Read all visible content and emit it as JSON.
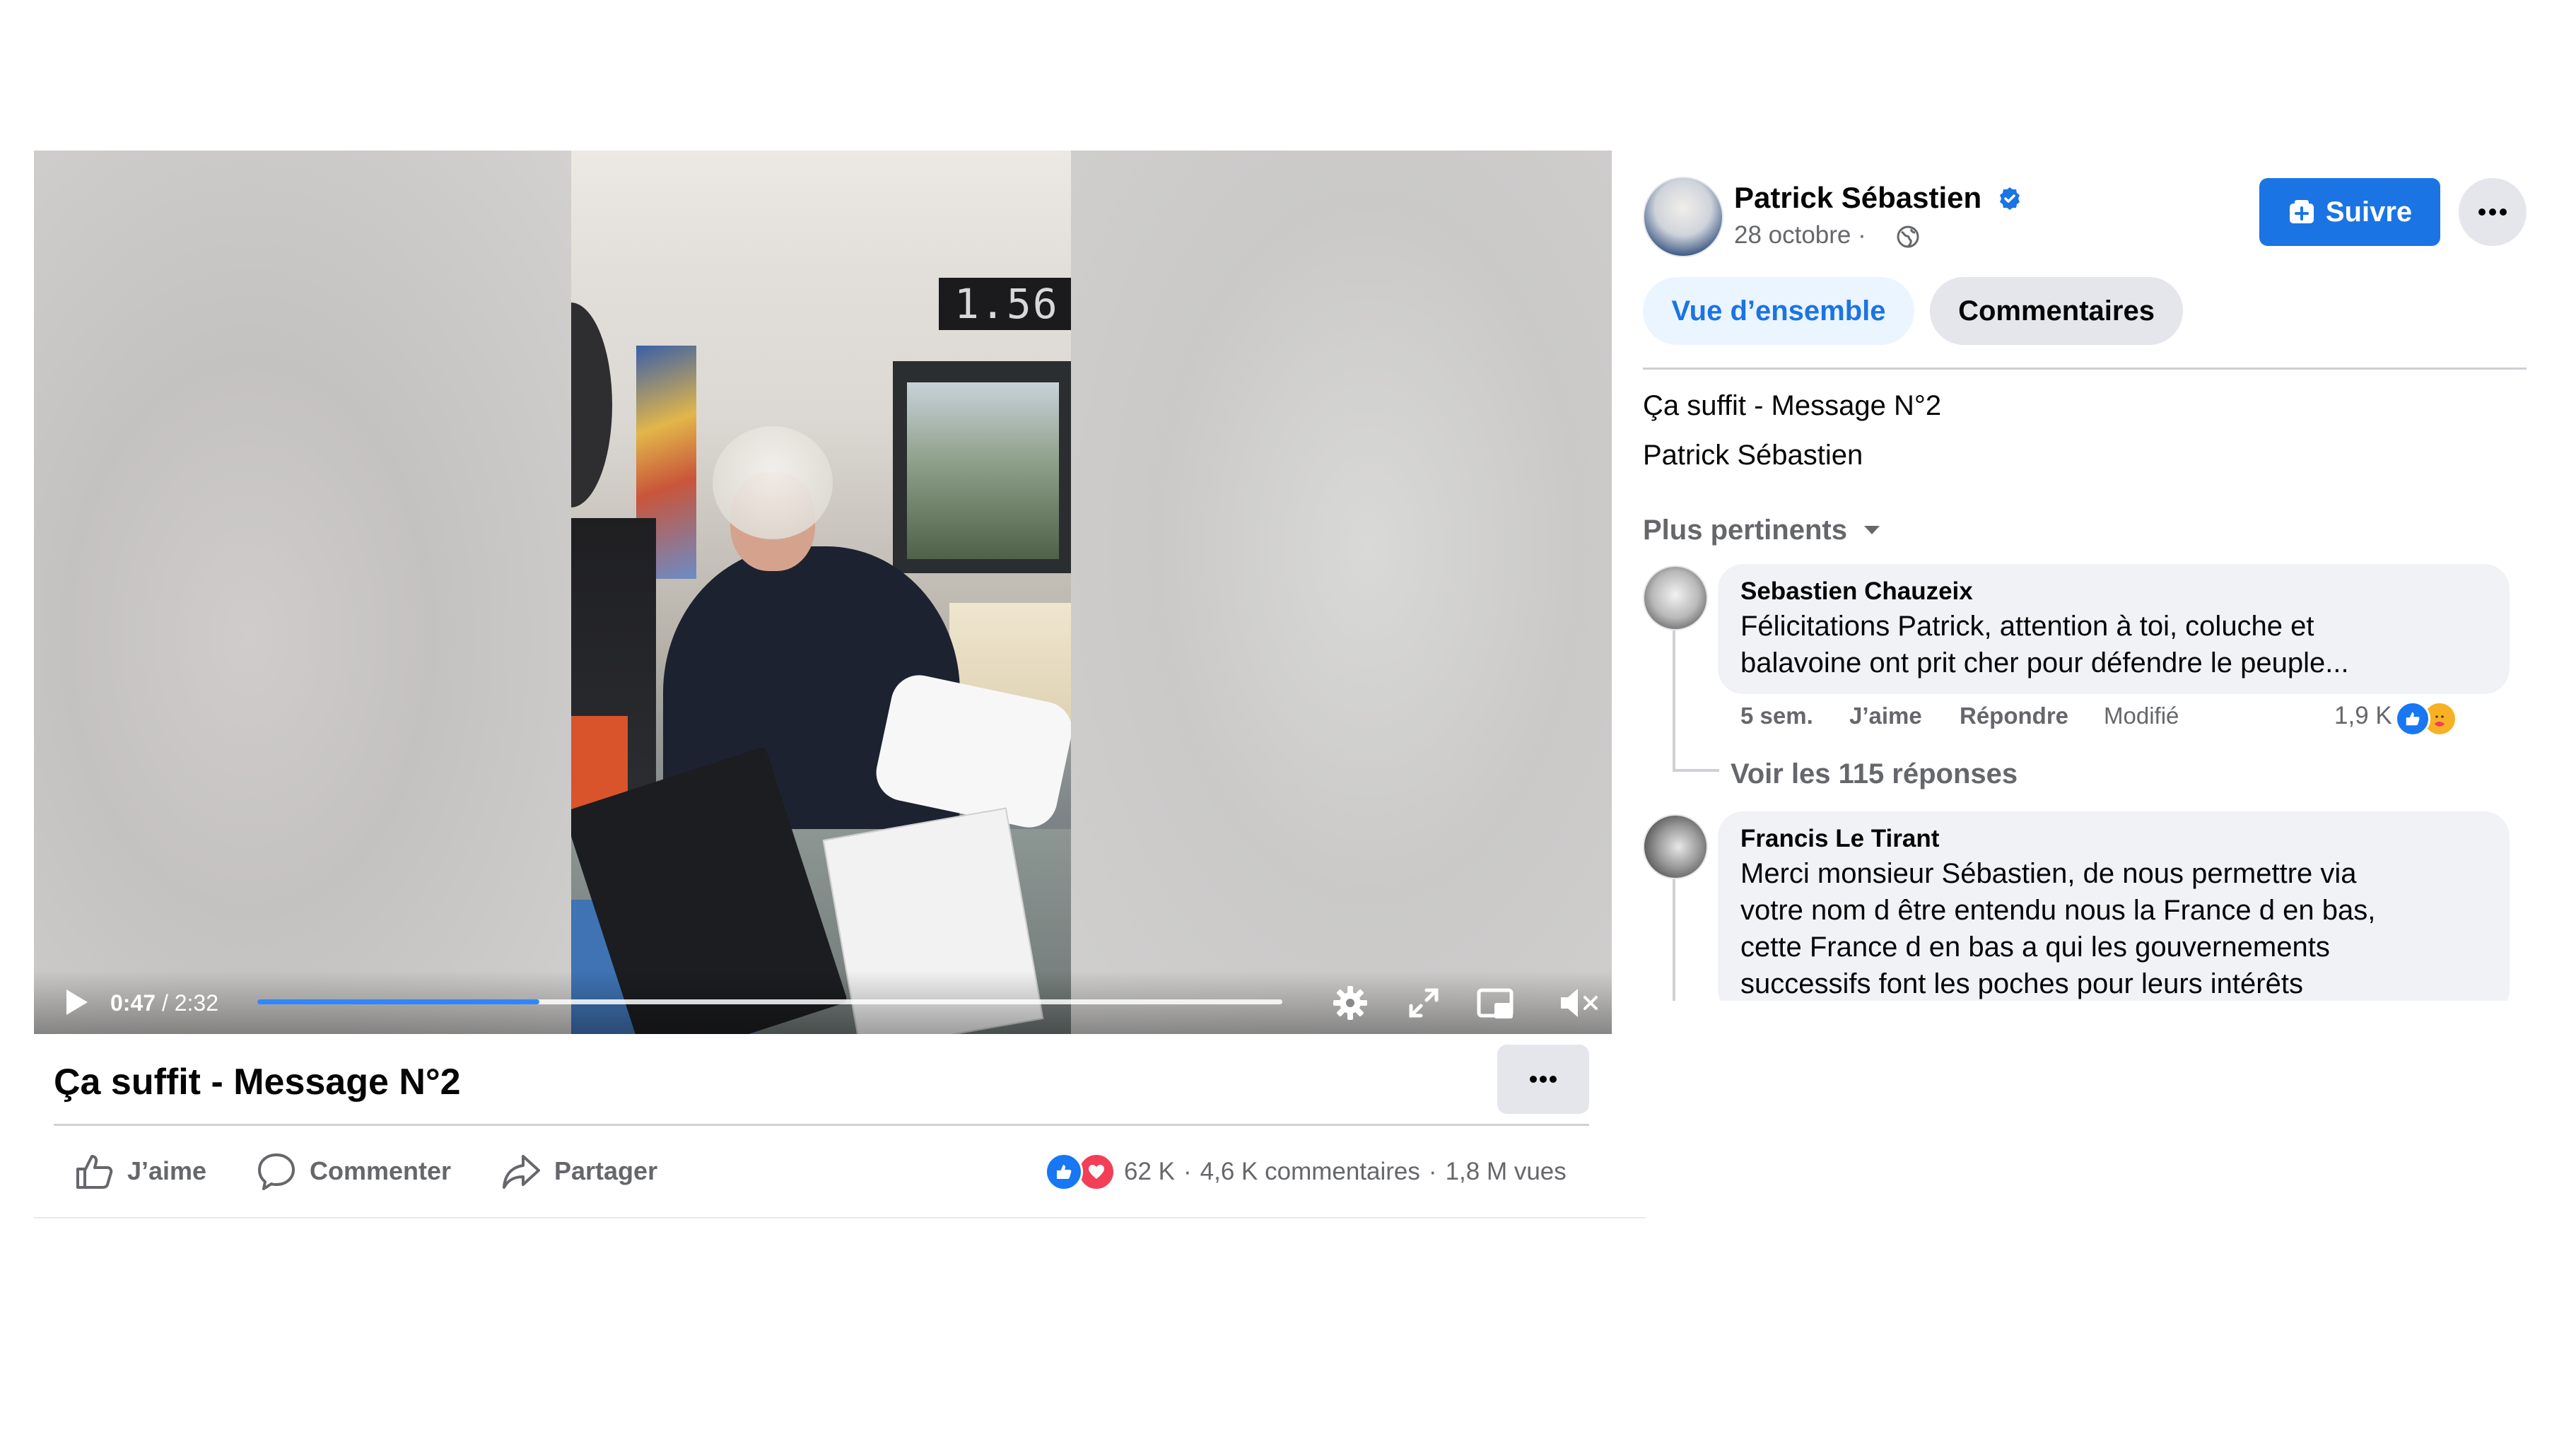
{
  "video": {
    "scene": {
      "clock_digits": "1.56"
    },
    "controls": {
      "current_time": "0:47",
      "duration": "/ 2:32",
      "progress": 0.275
    },
    "title": "Ça suffit - Message N°2"
  },
  "actions": {
    "like_label": "J’aime",
    "comment_label": "Commenter",
    "share_label": "Partager"
  },
  "stats": {
    "reaction_count": "62 K",
    "comments": "4,6 K commentaires",
    "views": "1,8 M vues",
    "separator": "·"
  },
  "post": {
    "author": "Patrick Sébastien",
    "date": "28 octobre ·",
    "follow_label": "Suivre",
    "tabs": [
      {
        "label": "Vue d’ensemble"
      },
      {
        "label": "Commentaires"
      }
    ],
    "description_title": "Ça suffit - Message N°2",
    "description_author": "Patrick Sébastien",
    "sort_label": "Plus pertinents"
  },
  "comments": [
    {
      "name": "Sebastien Chauzeix",
      "text_lines": [
        "Félicitations Patrick, attention à toi, coluche et",
        "balavoine ont prit cher pour défendre le peuple..."
      ],
      "time": "5 sem.",
      "like": "J’aime",
      "reply": "Répondre",
      "edited": "Modifié",
      "reactions": "1,9 K",
      "replies_link": "Voir les 115 réponses"
    },
    {
      "name": "Francis Le Tirant",
      "text_lines": [
        "Merci monsieur Sébastien, de nous permettre via",
        "votre nom d être entendu nous la France d en bas,",
        "cette France d en bas a qui les gouvernements",
        "successifs font les poches pour leurs intérêts"
      ]
    }
  ],
  "colors": {
    "accent": "#1b74e4",
    "progress": "#2d88ff",
    "secondary_text": "#65676b",
    "button_gray": "#e4e6eb",
    "like_blue": "#1877f2",
    "love_red": "#f33e58"
  },
  "icons": {
    "play": "play-icon",
    "settings": "gear-icon",
    "fullscreen": "expand-icon",
    "pip": "picture-in-picture-icon",
    "mute": "muted-speaker-icon",
    "like": "thumbs-up-icon",
    "comment": "speech-bubble-icon",
    "share": "share-arrow-icon",
    "verified": "verified-badge-icon",
    "globe": "globe-icon",
    "follow": "add-follow-icon",
    "more": "ellipsis-icon",
    "sort": "caret-down-icon"
  }
}
